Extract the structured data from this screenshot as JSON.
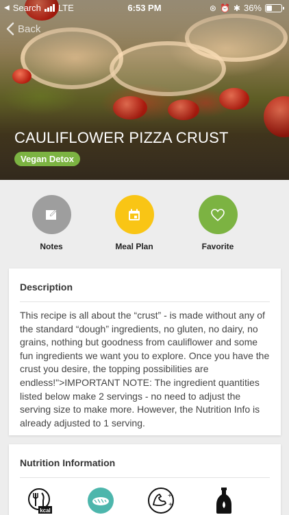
{
  "status_bar": {
    "back_app": "Search",
    "carrier": "LTE",
    "time": "6:53 PM",
    "battery": "36%",
    "battery_level": 0.36
  },
  "nav": {
    "back_label": "Back"
  },
  "recipe": {
    "title": "CAULIFLOWER PIZZA CRUST",
    "tag": "Vegan Detox"
  },
  "actions": [
    {
      "label": "Notes",
      "icon": "edit-note-icon",
      "color": "#9e9e9e"
    },
    {
      "label": "Meal Plan",
      "icon": "calendar-icon",
      "color": "#f9c515"
    },
    {
      "label": "Favorite",
      "icon": "heart-icon",
      "color": "#7cb342"
    }
  ],
  "description": {
    "heading": "Description",
    "text": "This recipe is all about the “crust” - is made without any of the standard “dough” ingredients, no gluten, no dairy, no grains, nothing but goodness from cauliflower and some fun ingredients we want you to explore. Once you have the crust you desire, the topping possibilities are endless!\">IMPORTANT NOTE: The ingredient quantities listed below make 2 servings - no need to adjust the serving size to make more. However, the Nutrition Info is already adjusted to 1 serving."
  },
  "nutrition": {
    "heading": "Nutrition Information",
    "icons": [
      "kcal-fork-knife-icon",
      "bread-carbs-icon",
      "muscle-protein-icon",
      "oil-bottle-fat-icon"
    ],
    "kcal_badge": "kcal",
    "teal": "#4db6ac"
  }
}
